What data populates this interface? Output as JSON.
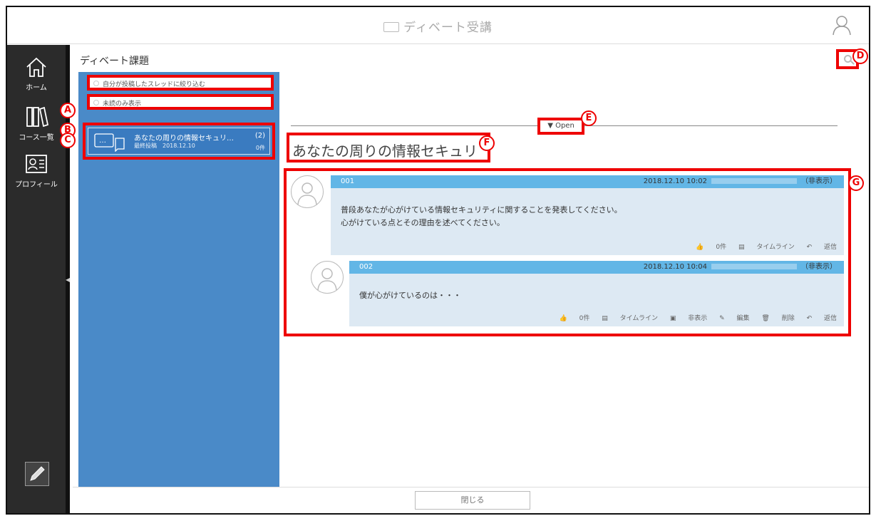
{
  "app": {
    "title": "ディベート受講"
  },
  "nav": {
    "home": "ホーム",
    "courses": "コース一覧",
    "profile": "プロフィール"
  },
  "page": {
    "title": "ディベート課題"
  },
  "filters": {
    "own_posts": "自分が投稿したスレッドに絞り込む",
    "unread_only": "未読のみ表示"
  },
  "thread_card": {
    "title": "あなたの周りの情報セキュリ…",
    "count": "(2)",
    "date": "最終投稿　2018.12.10",
    "likes": "0件"
  },
  "toggle": {
    "label": "▼ Open"
  },
  "thread": {
    "title": "あなたの周りの情報セキュリ"
  },
  "posts": [
    {
      "no": "001",
      "datetime": "2018.12.10 10:02",
      "status": "（非表示）",
      "lines": [
        "普段あなたが心がけている情報セキュリティに関することを発表してください。",
        "心がけている点とその理由を述べてください。"
      ],
      "actions": [
        "0件",
        "タイムライン",
        "返信"
      ]
    },
    {
      "no": "002",
      "datetime": "2018.12.10 10:04",
      "status": "（非表示）",
      "lines": [
        "僕が心がけているのは・・・"
      ],
      "actions": [
        "0件",
        "タイムライン",
        "非表示",
        "編集",
        "削除",
        "返信"
      ]
    }
  ],
  "markers": {
    "a": "A",
    "b": "B",
    "c": "C",
    "d": "D",
    "e": "E",
    "f": "F",
    "g": "G"
  },
  "footer": {
    "close_label": "閉じる"
  },
  "colors": {
    "panel": "#4a8ac8",
    "header_bar": "#62b6e6",
    "highlight": "#ee0000",
    "nav_bg": "#2b2b2b"
  }
}
